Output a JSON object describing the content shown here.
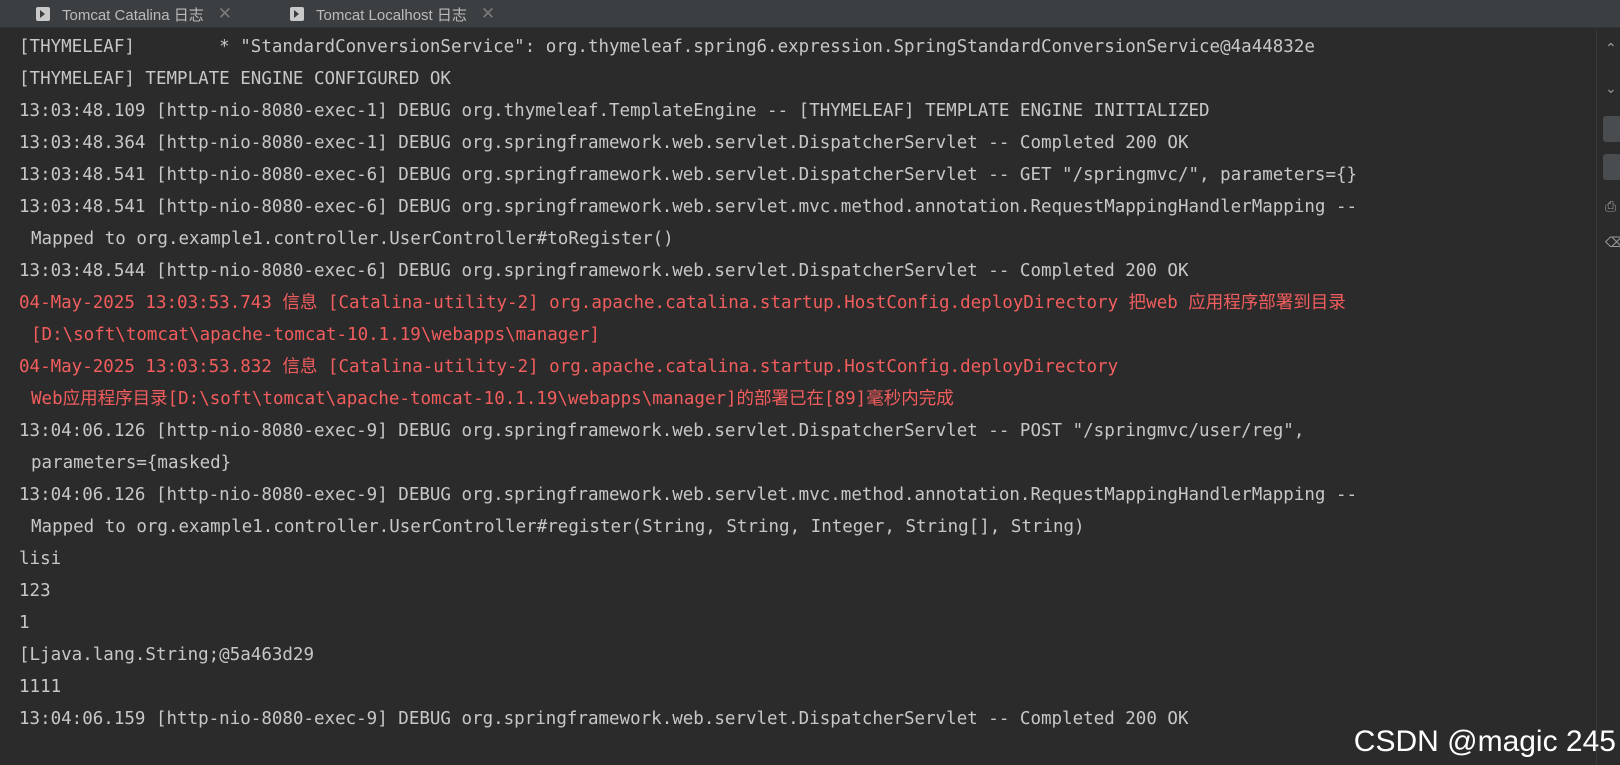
{
  "tabs": [
    {
      "label": "Tomcat Catalina 日志",
      "close": "✕",
      "icon": "terminal-icon"
    },
    {
      "label": "Tomcat Localhost 日志",
      "close": "✕",
      "icon": "terminal-icon"
    }
  ],
  "console": {
    "lines": [
      {
        "text": "[THYMELEAF]        * \"StandardConversionService\": org.thymeleaf.spring6.expression.SpringStandardConversionService@4a44832e",
        "level": "info"
      },
      {
        "text": "[THYMELEAF] TEMPLATE ENGINE CONFIGURED OK",
        "level": "info"
      },
      {
        "text": "13:03:48.109 [http-nio-8080-exec-1] DEBUG org.thymeleaf.TemplateEngine -- [THYMELEAF] TEMPLATE ENGINE INITIALIZED",
        "level": "info"
      },
      {
        "text": "13:03:48.364 [http-nio-8080-exec-1] DEBUG org.springframework.web.servlet.DispatcherServlet -- Completed 200 OK",
        "level": "info"
      },
      {
        "text": "13:03:48.541 [http-nio-8080-exec-6] DEBUG org.springframework.web.servlet.DispatcherServlet -- GET \"/springmvc/\", parameters={}",
        "level": "info"
      },
      {
        "text": "13:03:48.541 [http-nio-8080-exec-6] DEBUG org.springframework.web.servlet.mvc.method.annotation.RequestMappingHandlerMapping --",
        "level": "info"
      },
      {
        "text": "Mapped to org.example1.controller.UserController#toRegister()",
        "level": "info",
        "cont": true
      },
      {
        "text": "13:03:48.544 [http-nio-8080-exec-6] DEBUG org.springframework.web.servlet.DispatcherServlet -- Completed 200 OK",
        "level": "info"
      },
      {
        "text": "04-May-2025 13:03:53.743 信息 [Catalina-utility-2] org.apache.catalina.startup.HostConfig.deployDirectory 把web 应用程序部署到目录",
        "level": "err"
      },
      {
        "text": "[D:\\soft\\tomcat\\apache-tomcat-10.1.19\\webapps\\manager]",
        "level": "err",
        "cont": true
      },
      {
        "text": "04-May-2025 13:03:53.832 信息 [Catalina-utility-2] org.apache.catalina.startup.HostConfig.deployDirectory",
        "level": "err"
      },
      {
        "text": "Web应用程序目录[D:\\soft\\tomcat\\apache-tomcat-10.1.19\\webapps\\manager]的部署已在[89]毫秒内完成",
        "level": "err",
        "cont": true
      },
      {
        "text": "13:04:06.126 [http-nio-8080-exec-9] DEBUG org.springframework.web.servlet.DispatcherServlet -- POST \"/springmvc/user/reg\",",
        "level": "info"
      },
      {
        "text": "parameters={masked}",
        "level": "info",
        "cont": true
      },
      {
        "text": "13:04:06.126 [http-nio-8080-exec-9] DEBUG org.springframework.web.servlet.mvc.method.annotation.RequestMappingHandlerMapping --",
        "level": "info"
      },
      {
        "text": "Mapped to org.example1.controller.UserController#register(String, String, Integer, String[], String)",
        "level": "info",
        "cont": true
      },
      {
        "text": "lisi",
        "level": "info"
      },
      {
        "text": "123",
        "level": "info"
      },
      {
        "text": "1",
        "level": "info"
      },
      {
        "text": "[Ljava.lang.String;@5a463d29",
        "level": "info"
      },
      {
        "text": "1111",
        "level": "info"
      },
      {
        "text": "13:04:06.159 [http-nio-8080-exec-9] DEBUG org.springframework.web.servlet.DispatcherServlet -- Completed 200 OK",
        "level": "info"
      }
    ]
  },
  "watermark": "CSDN @magic 245",
  "colors": {
    "background": "#2b2b2b",
    "text": "#c7c7c7",
    "error_text": "#f25d5d",
    "tabbar": "#3c3f41"
  }
}
